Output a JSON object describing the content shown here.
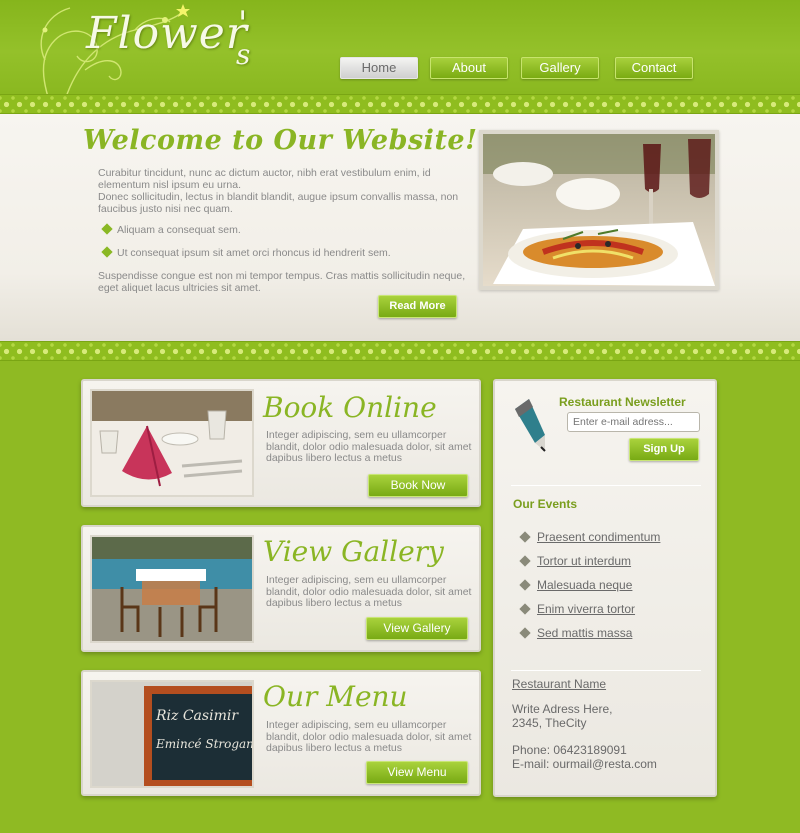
{
  "header": {
    "logo_text": "Flower",
    "logo_apos": "'",
    "logo_s": "s"
  },
  "nav": [
    {
      "label": "Home",
      "active": true
    },
    {
      "label": "About"
    },
    {
      "label": "Gallery"
    },
    {
      "label": "Contact"
    }
  ],
  "welcome": {
    "title": "Welcome to Our Website!",
    "para1": "Curabitur tincidunt, nunc ac dictum auctor, nibh erat vestibulum enim, id elementum nisl ipsum eu urna.",
    "para2": "Donec sollicitudin, lectus in blandit blandit, augue ipsum convallis massa, non faucibus justo nisi nec quam.",
    "bullets": [
      "Aliquam a consequat sem.",
      "Ut consequat ipsum sit amet orci rhoncus id hendrerit sem."
    ],
    "para3": "Suspendisse congue est non mi tempor tempus. Cras mattis sollicitudin neque, eget aliquet lacus ultricies sit amet.",
    "read_more": "Read More"
  },
  "cards": [
    {
      "title": "Book Online",
      "text": "Integer adipiscing, sem eu ullamcorper blandit, dolor odio malesuada dolor, sit amet dapibus libero lectus a metus",
      "button": "Book Now"
    },
    {
      "title": "View Gallery",
      "text": "Integer adipiscing, sem eu ullamcorper blandit, dolor odio malesuada dolor, sit amet dapibus libero lectus a metus",
      "button": "View Gallery"
    },
    {
      "title": "Our Menu",
      "text": "Integer adipiscing, sem eu ullamcorper blandit, dolor odio malesuada dolor, sit amet dapibus libero lectus a metus",
      "button": "View Menu"
    }
  ],
  "menu_board": {
    "line1": "Riz Casimir",
    "line2": "Emincé Stroganoff"
  },
  "newsletter": {
    "title": "Restaurant Newsletter",
    "placeholder": "Enter e-mail adress...",
    "button": "Sign Up"
  },
  "events": {
    "title": "Our Events",
    "items": [
      "Praesent condimentum",
      "Tortor ut interdum",
      "Malesuada neque",
      "Enim viverra tortor",
      "Sed mattis massa"
    ]
  },
  "contact": {
    "name": "Restaurant Name",
    "address1": "Write Adress Here,",
    "address2": "2345, TheCity",
    "phone": "Phone: 06423189091",
    "email": "E-mail: ourmail@resta.com"
  },
  "colors": {
    "accent": "#8ab524",
    "background": "#8fba23",
    "panel": "#f4f2ec"
  }
}
